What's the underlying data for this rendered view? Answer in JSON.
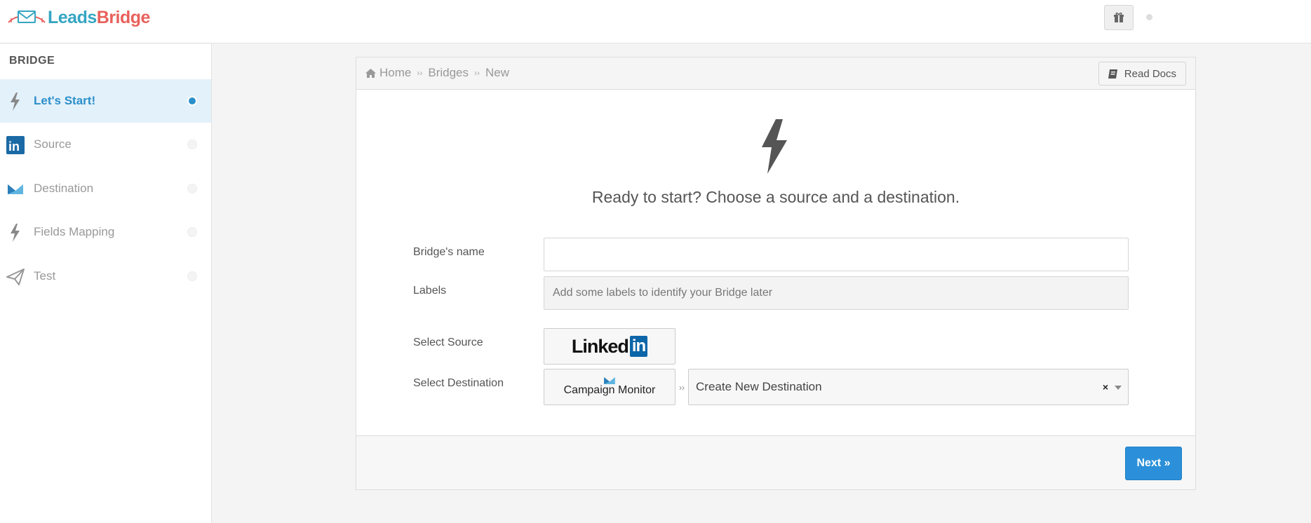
{
  "brand": {
    "name_part1": "Leads",
    "name_part2": "Bridge",
    "color1": "#34a5c2",
    "color2": "#e8615c"
  },
  "header": {
    "gift_icon": "gift-icon"
  },
  "sidebar": {
    "title": "BRIDGE",
    "steps": [
      {
        "label": "Let's Start!",
        "icon": "bolt-icon",
        "active": true
      },
      {
        "label": "Source",
        "icon": "linkedin-icon",
        "active": false
      },
      {
        "label": "Destination",
        "icon": "campaign-monitor-icon",
        "active": false
      },
      {
        "label": "Fields Mapping",
        "icon": "bolt-icon",
        "active": false
      },
      {
        "label": "Test",
        "icon": "paper-plane-icon",
        "active": false
      }
    ]
  },
  "breadcrumb": {
    "home": "Home",
    "bridges": "Bridges",
    "current": "New",
    "separator": "››"
  },
  "read_docs": {
    "label": "Read Docs"
  },
  "main": {
    "headline": "Ready to start? Choose a source and a destination.",
    "form": {
      "name_label": "Bridge's name",
      "name_value": "",
      "labels_label": "Labels",
      "labels_placeholder": "Add some labels to identify your Bridge later",
      "source_label": "Select Source",
      "source_name_part1": "Linked",
      "source_name_part2": "in",
      "destination_label": "Select Destination",
      "destination_name": "Campaign Monitor",
      "destination_select": "Create New Destination",
      "clear_symbol": "×",
      "separator": "››"
    }
  },
  "footer": {
    "next_label": "Next »"
  },
  "colors": {
    "accent": "#2b90d9",
    "active_bg": "#e3f1fb"
  }
}
